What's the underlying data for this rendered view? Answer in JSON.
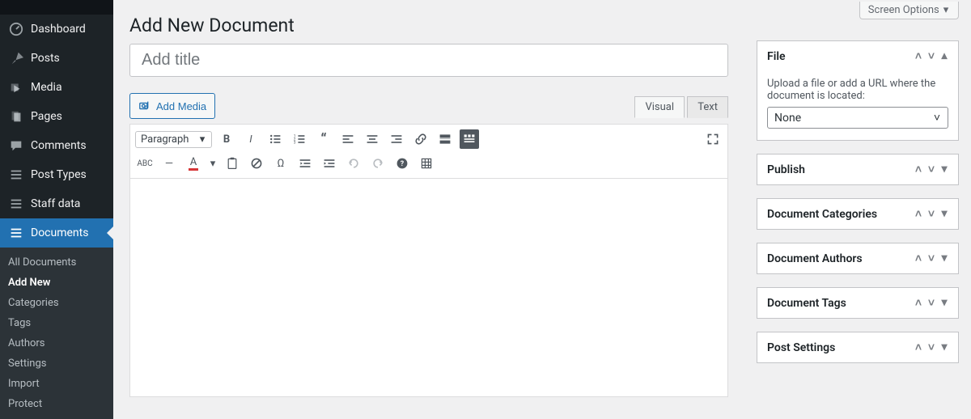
{
  "header": {
    "screen_options": "Screen Options"
  },
  "sidebar": {
    "items": [
      {
        "label": "Dashboard",
        "icon": "dashboard"
      },
      {
        "label": "Posts",
        "icon": "pin"
      },
      {
        "label": "Media",
        "icon": "media"
      },
      {
        "label": "Pages",
        "icon": "pages"
      },
      {
        "label": "Comments",
        "icon": "comments"
      },
      {
        "label": "Post Types",
        "icon": "list"
      },
      {
        "label": "Staff data",
        "icon": "list"
      },
      {
        "label": "Documents",
        "icon": "list"
      }
    ],
    "sub": [
      {
        "label": "All Documents"
      },
      {
        "label": "Add New",
        "current": true
      },
      {
        "label": "Categories"
      },
      {
        "label": "Tags"
      },
      {
        "label": "Authors"
      },
      {
        "label": "Settings"
      },
      {
        "label": "Import"
      },
      {
        "label": "Protect"
      }
    ]
  },
  "page": {
    "title": "Add New Document",
    "title_placeholder": "Add title",
    "add_media": "Add Media",
    "tab_visual": "Visual",
    "tab_text": "Text",
    "format_select": "Paragraph"
  },
  "panels": {
    "file": {
      "title": "File",
      "desc": "Upload a file or add a URL where the document is located:",
      "select_value": "None"
    },
    "publish": "Publish",
    "categories": "Document Categories",
    "authors": "Document Authors",
    "tags": "Document Tags",
    "settings": "Post Settings"
  }
}
